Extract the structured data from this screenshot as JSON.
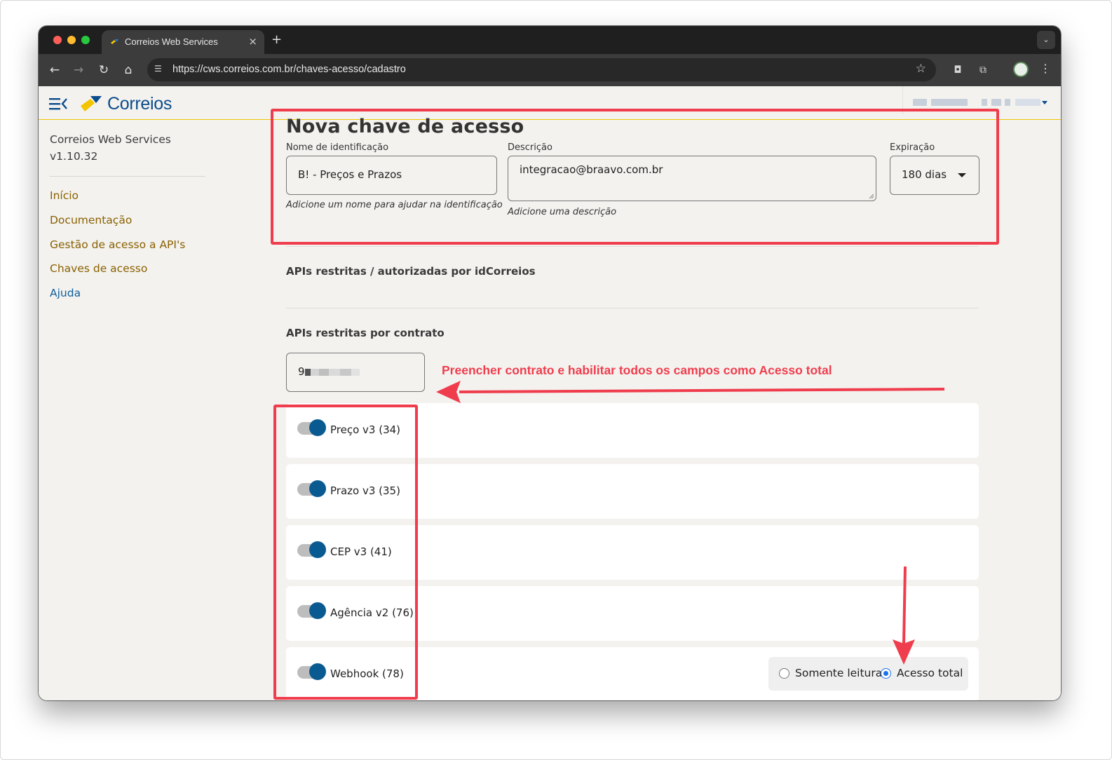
{
  "browser": {
    "tab_title": "Correios Web Services",
    "tab_close": "×",
    "new_tab": "+",
    "url": "https://cws.correios.com.br/chaves-acesso/cadastro"
  },
  "header": {
    "logo_text": "Correios"
  },
  "sidebar": {
    "app_name": "Correios Web Services",
    "version": "v1.10.32",
    "links": [
      "Início",
      "Documentação",
      "Gestão de acesso a API's",
      "Chaves de acesso",
      "Ajuda"
    ]
  },
  "form": {
    "title": "Nova chave de acesso",
    "name_label": "Nome de identificação",
    "name_value": "B! - Preços e Prazos",
    "name_hint": "Adicione um nome para ajudar na identificação",
    "desc_label": "Descrição",
    "desc_value": "integracao@braavo.com.br",
    "desc_hint": "Adicione uma descrição",
    "exp_label": "Expiração",
    "exp_value": "180 dias"
  },
  "sections": {
    "restricted_id": "APIs restritas / autorizadas por idCorreios",
    "restricted_contract": "APIs restritas por contrato",
    "contract_value_visible": "9"
  },
  "apis": [
    {
      "label": "Preço v3 (34)",
      "enabled": true
    },
    {
      "label": "Prazo v3 (35)",
      "enabled": true
    },
    {
      "label": "CEP v3 (41)",
      "enabled": true
    },
    {
      "label": "Agência v2 (76)",
      "enabled": true
    },
    {
      "label": "Webhook (78)",
      "enabled": true
    }
  ],
  "access": {
    "read_only": "Somente leitura",
    "full": "Acesso total",
    "selected": "Acesso total"
  },
  "annotation": {
    "text": "Preencher contrato e habilitar todos os campos como Acesso total",
    "color": "#f03d4d"
  },
  "colors": {
    "accent_gold": "#8a6100",
    "toggle_on": "#0a5a92",
    "brand_blue": "#0b4c8c",
    "brand_yellow": "#f2c500"
  }
}
